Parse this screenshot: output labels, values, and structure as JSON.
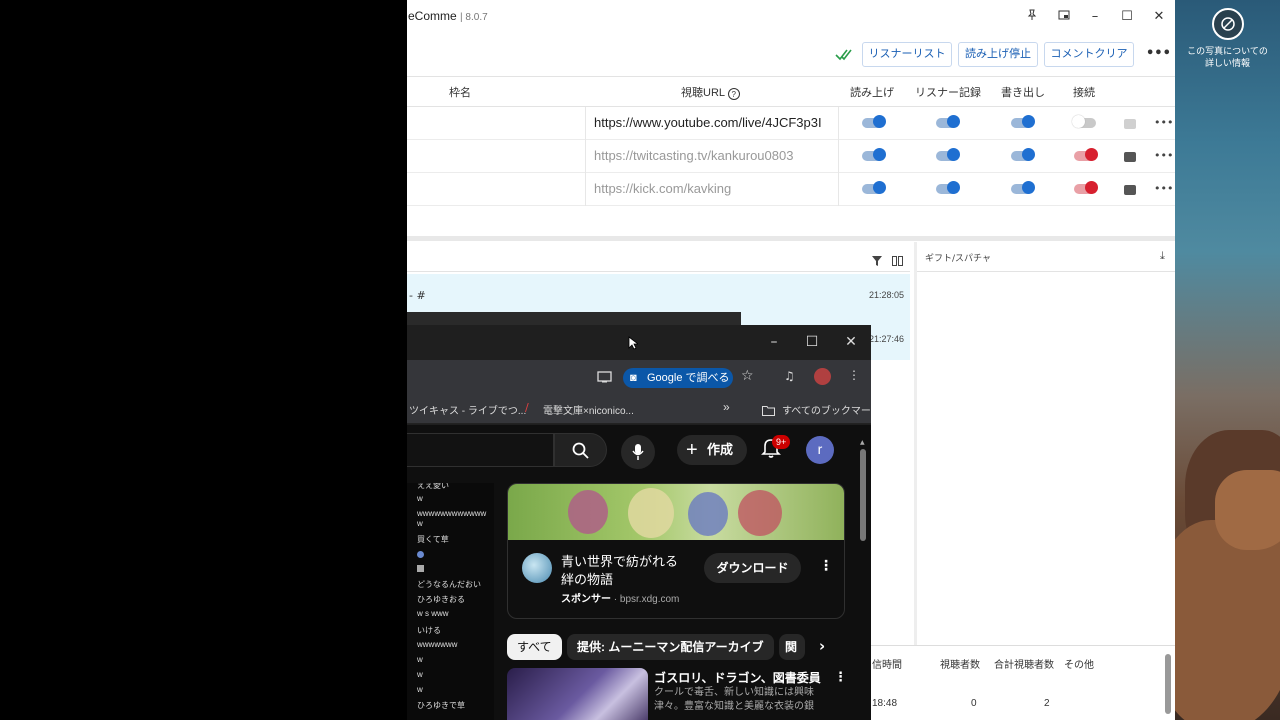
{
  "app": {
    "title": "eComme",
    "version": "8.0.7",
    "toolbar": {
      "listener_list": "リスナーリスト",
      "stop_reading": "読み上げ停止",
      "clear_comments": "コメントクリア"
    },
    "columns": {
      "frame_name": "枠名",
      "url": "視聴URL",
      "read": "読み上げ",
      "listener_log": "リスナー記録",
      "export": "書き出し",
      "connect": "接続"
    },
    "rows": [
      {
        "url": "https://www.youtube.com/live/4JCF3p3I",
        "read": true,
        "listener": true,
        "export": true,
        "connect": "off"
      },
      {
        "url": "https://twitcasting.tv/kankurou0803",
        "read": true,
        "listener": true,
        "export": true,
        "connect": "red"
      },
      {
        "url": "https://kick.com/kavking",
        "read": true,
        "listener": true,
        "export": true,
        "connect": "red"
      }
    ],
    "gift_panel": "ギフト/スパチャ",
    "comment_hash": "- #",
    "time1": "21:28:05",
    "time2": "21:27:46",
    "stats": {
      "h_time": "信時間",
      "h_viewers": "視聴者数",
      "h_total": "合計視聴者数",
      "h_other": "その他",
      "v_time": "18:48",
      "v_viewers": "0",
      "v_total": "2"
    }
  },
  "wallpaper": {
    "info_text_1": "この写真についての",
    "info_text_2": "詳しい情報"
  },
  "chrome": {
    "google_search": "Google で調べる",
    "bookmarks": {
      "b1": "ツイキャス - ライブでつ...",
      "b2": "電撃文庫×niconico...",
      "more": "»",
      "all": "すべてのブックマーク"
    },
    "youtube": {
      "create": "作成",
      "badge": "9+",
      "avatar": "r",
      "ad_title_1": "青い世界で紡がれる",
      "ad_title_2": "絆の物語",
      "ad_sponsor": "スポンサー",
      "ad_domain": "bpsr.xdg.com",
      "ad_download": "ダウンロード",
      "chips": {
        "all": "すべて",
        "provided": "提供: ムーニーマン配信アーカイブ",
        "next": "関"
      },
      "video_title": "ゴスロリ、ドラゴン、図書委員",
      "video_desc_1": "クールで毒舌、新しい知識には興味",
      "video_desc_2": "津々。豊富な知識と美麗な衣装の銀",
      "chat": [
        "ええ愛い",
        "w",
        "wwwwwwwwwwww",
        "w",
        "買くて草",
        "",
        "",
        "どうなるんだおい",
        "ひろゆきおる",
        "w s www",
        "いける",
        "wwwwwww",
        "w",
        "w",
        "w",
        "ひろゆきで草"
      ]
    }
  }
}
